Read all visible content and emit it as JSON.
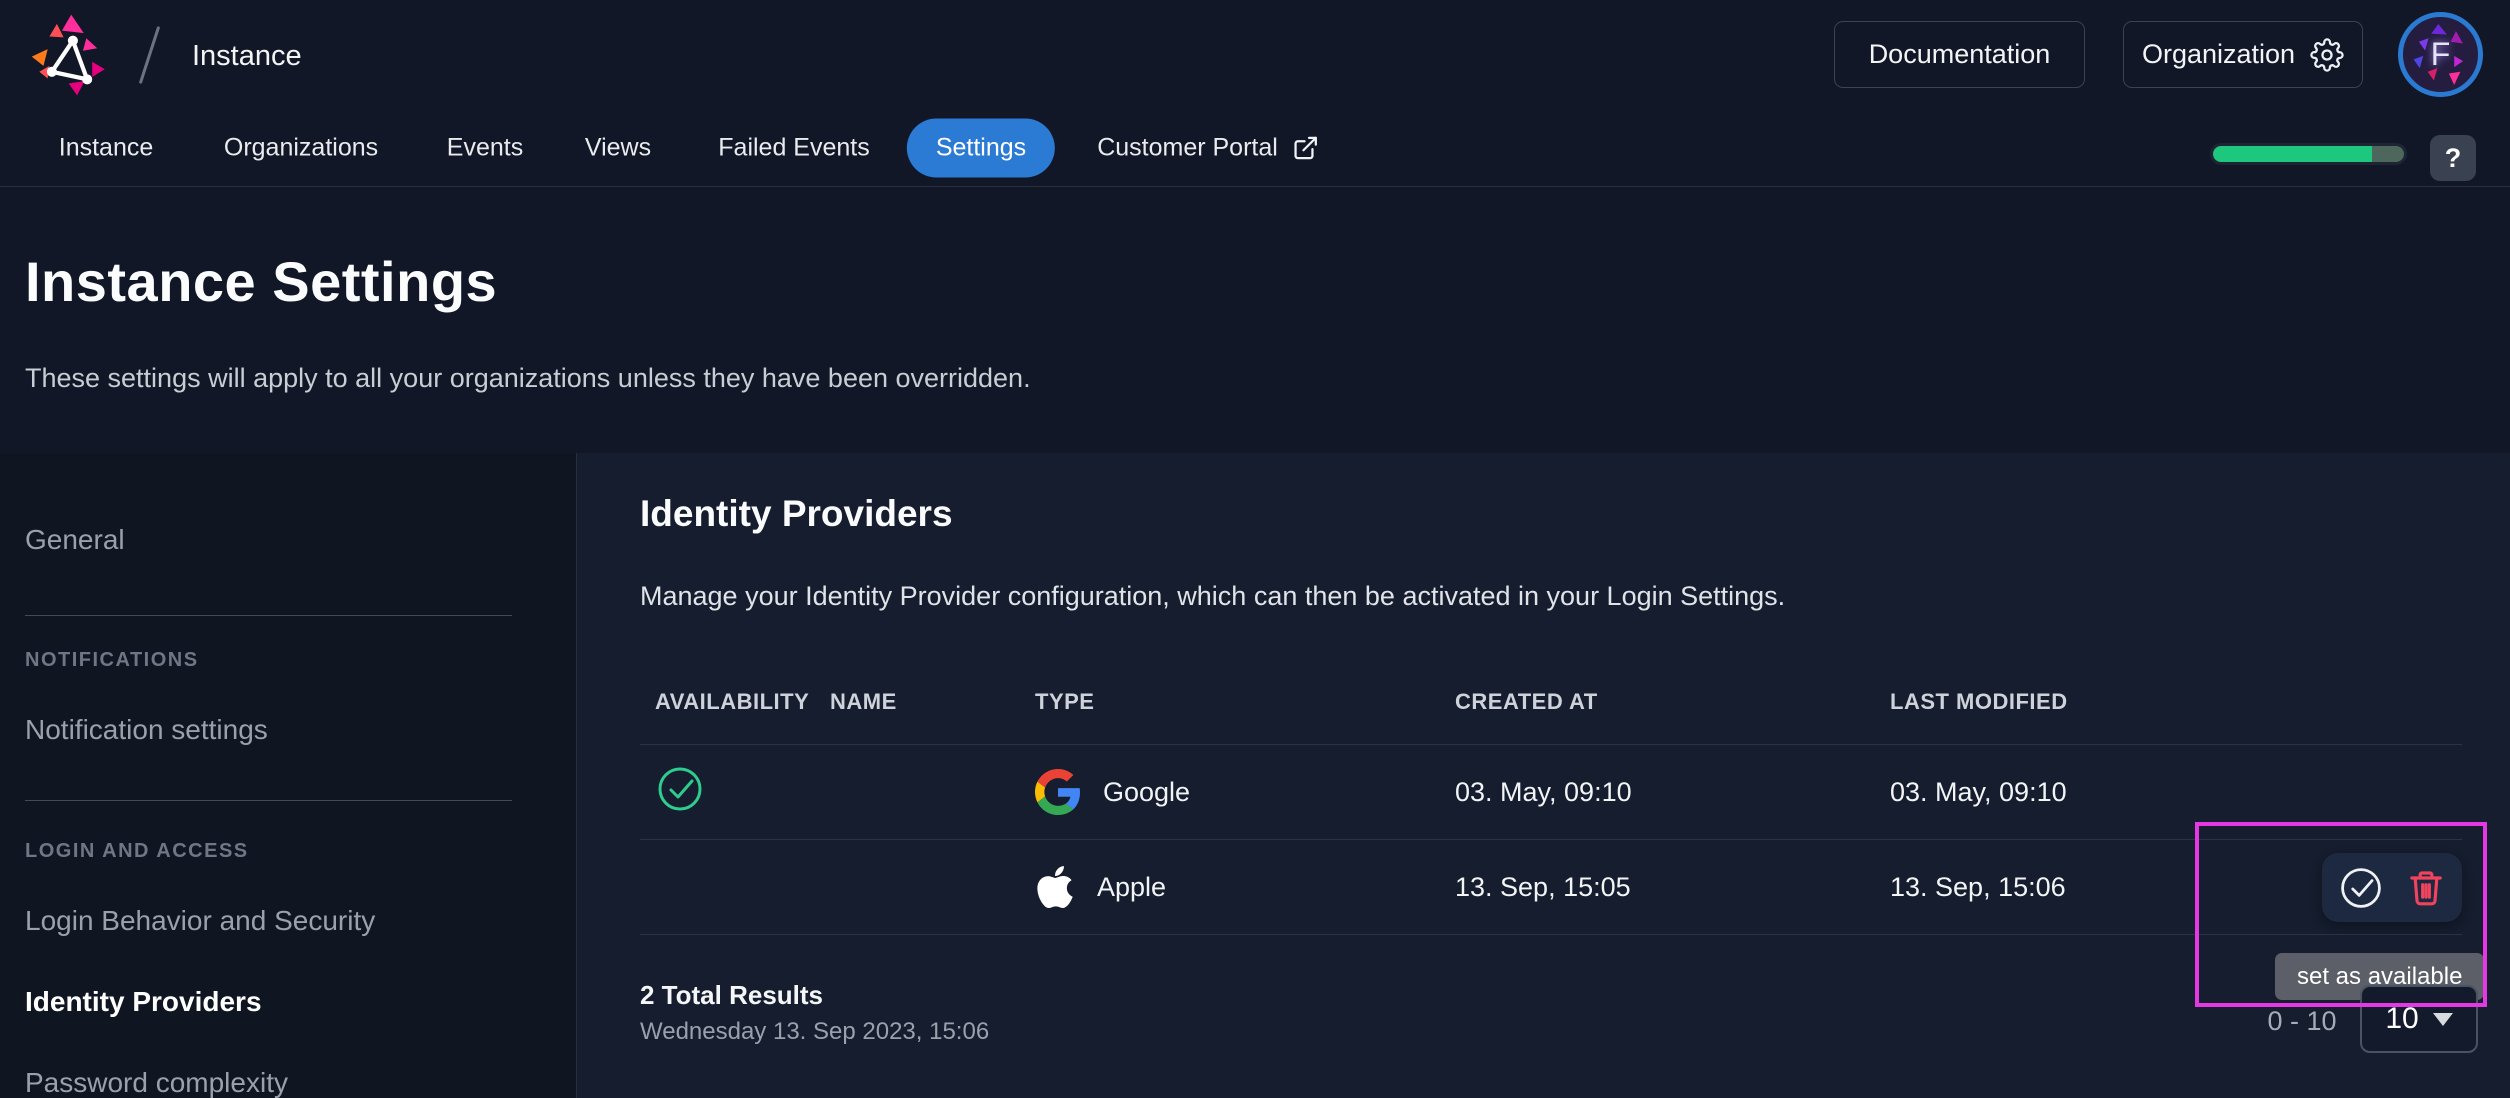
{
  "header": {
    "breadcrumb": "Instance",
    "documentation_label": "Documentation",
    "organization_label": "Organization",
    "avatar_letter": "F"
  },
  "nav": {
    "tabs": [
      {
        "label": "Instance",
        "active": false
      },
      {
        "label": "Organizations",
        "active": false
      },
      {
        "label": "Events",
        "active": false
      },
      {
        "label": "Views",
        "active": false
      },
      {
        "label": "Failed Events",
        "active": false
      },
      {
        "label": "Settings",
        "active": true
      },
      {
        "label": "Customer Portal",
        "active": false,
        "external": true
      }
    ],
    "quota_progress_percent": 83,
    "help_label": "?"
  },
  "page": {
    "title": "Instance Settings",
    "subtitle": "These settings will apply to all your organizations unless they have been overridden."
  },
  "sidebar": {
    "general_label": "General",
    "sections": [
      {
        "heading": "NOTIFICATIONS",
        "items": [
          {
            "label": "Notification settings",
            "active": false
          }
        ]
      },
      {
        "heading": "LOGIN AND ACCESS",
        "items": [
          {
            "label": "Login Behavior and Security",
            "active": false
          },
          {
            "label": "Identity Providers",
            "active": true
          },
          {
            "label": "Password complexity",
            "active": false
          }
        ]
      }
    ]
  },
  "content": {
    "section_title": "Identity Providers",
    "section_description": "Manage your Identity Provider configuration, which can then be activated in your Login Settings.",
    "table": {
      "columns": [
        "AVAILABILITY",
        "NAME",
        "TYPE",
        "CREATED AT",
        "LAST MODIFIED"
      ],
      "rows": [
        {
          "available": true,
          "name": "",
          "type": "Google",
          "icon": "google-logo",
          "created_at": "03. May, 09:10",
          "last_modified": "03. May, 09:10"
        },
        {
          "available": false,
          "name": "",
          "type": "Apple",
          "icon": "apple-logo",
          "created_at": "13. Sep, 15:05",
          "last_modified": "13. Sep, 15:06"
        }
      ]
    },
    "footer": {
      "total": "2 Total Results",
      "timestamp": "Wednesday 13. Sep 2023, 15:06",
      "range": "0 - 10",
      "page_size": "10"
    },
    "tooltip": "set as available"
  },
  "icons": {
    "availability": "check-circle-icon",
    "set_available_action": "check-circle-icon",
    "delete_action": "trash-icon",
    "organization_button": "gear-icon",
    "customer_portal": "external-link-icon"
  },
  "colors": {
    "accent_blue": "#2b7bd4",
    "success_green": "#2ecc8e",
    "danger_red": "#f1435d",
    "annotation_magenta": "#e438e4",
    "progress_green": "#1ec77e"
  }
}
